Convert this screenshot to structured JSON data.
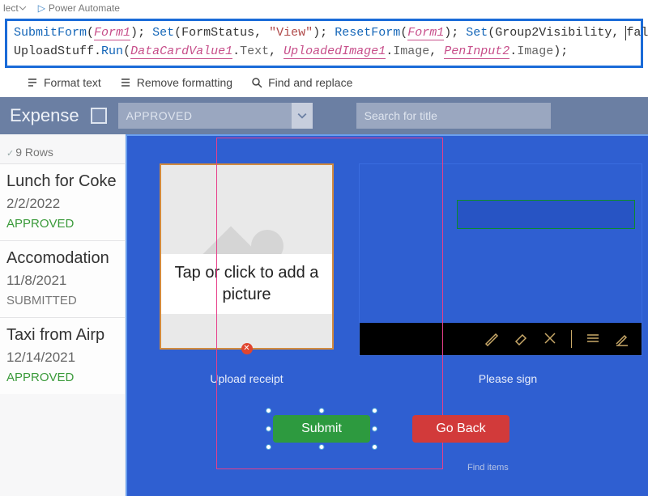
{
  "ribbon": {
    "item1": "lect",
    "item2": "Power Automate"
  },
  "formula": {
    "tokens": [
      "SubmitForm",
      "(",
      "Form1",
      ")",
      "; ",
      "Set",
      "(",
      "FormStatus",
      ", ",
      "\"View\"",
      ")",
      "; ",
      "ResetForm",
      "(",
      "Form1",
      ")",
      "; ",
      "Set",
      "(",
      "Group2Visibility",
      ", ",
      "false",
      ")",
      ";",
      "\n",
      "UploadStuff",
      ".",
      "Run",
      "(",
      "DataCardValue1",
      ".",
      "Text",
      ", ",
      "UploadedImage1",
      ".",
      "Image",
      ", ",
      "PenInput2",
      ".",
      "Image",
      ")",
      ";"
    ]
  },
  "editorToolbar": {
    "format": "Format text",
    "remove": "Remove formatting",
    "find": "Find and replace"
  },
  "header": {
    "title": "Expense",
    "dropdown": "APPROVED",
    "search_placeholder": "Search for title"
  },
  "rows_label": "9 Rows",
  "items": [
    {
      "title": "Lunch for Coke",
      "date": "2/2/2022",
      "status": "APPROVED",
      "status_class": "status-approved"
    },
    {
      "title": "Accomodation",
      "date": "11/8/2021",
      "status": "SUBMITTED",
      "status_class": "status-submitted"
    },
    {
      "title": "Taxi from Airp",
      "date": "12/14/2021",
      "status": "APPROVED",
      "status_class": "status-approved"
    }
  ],
  "canvas": {
    "upload_tap": "Tap or click to add a picture",
    "upload_caption": "Upload receipt",
    "sign_caption": "Please sign",
    "submit": "Submit",
    "goback": "Go Back",
    "find_items": "Find items"
  }
}
